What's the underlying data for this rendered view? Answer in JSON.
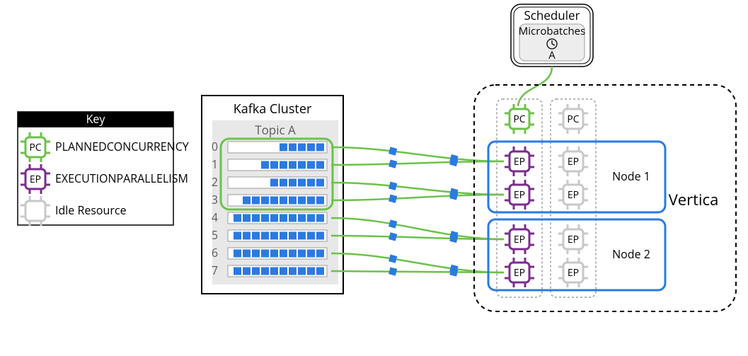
{
  "key": {
    "title": "Key",
    "items": [
      {
        "chip": "PC",
        "label": "PLANNEDCONCURRENCY",
        "color": "#6cc24a",
        "textcolor": "#5aa63c"
      },
      {
        "chip": "EP",
        "label": "EXECUTIONPARALLELISM",
        "color": "#7b2d8e",
        "textcolor": "#7b2d8e"
      },
      {
        "chip": "",
        "label": "Idle Resource",
        "color": "#c8c8c8",
        "textcolor": "#c8c8c8"
      }
    ]
  },
  "kafka": {
    "title": "Kafka Cluster",
    "topic": "Topic A",
    "partitions": [
      "0",
      "1",
      "2",
      "3",
      "4",
      "5",
      "6",
      "7"
    ]
  },
  "scheduler": {
    "title": "Scheduler",
    "sub": "Microbatches",
    "mb": "A"
  },
  "vertica": {
    "title": "Vertica",
    "pc_active": "PC",
    "pc_idle": "PC",
    "ep_active": "EP",
    "ep_idle": "EP",
    "nodes": [
      "Node 1",
      "Node 2"
    ]
  },
  "colors": {
    "green": "#6cc24a",
    "purple": "#7b2d8e",
    "gray": "#c8c8c8",
    "blue": "#2b7ae0",
    "lightgray": "#e8e8e8",
    "boxline": "#9d9d9d"
  }
}
